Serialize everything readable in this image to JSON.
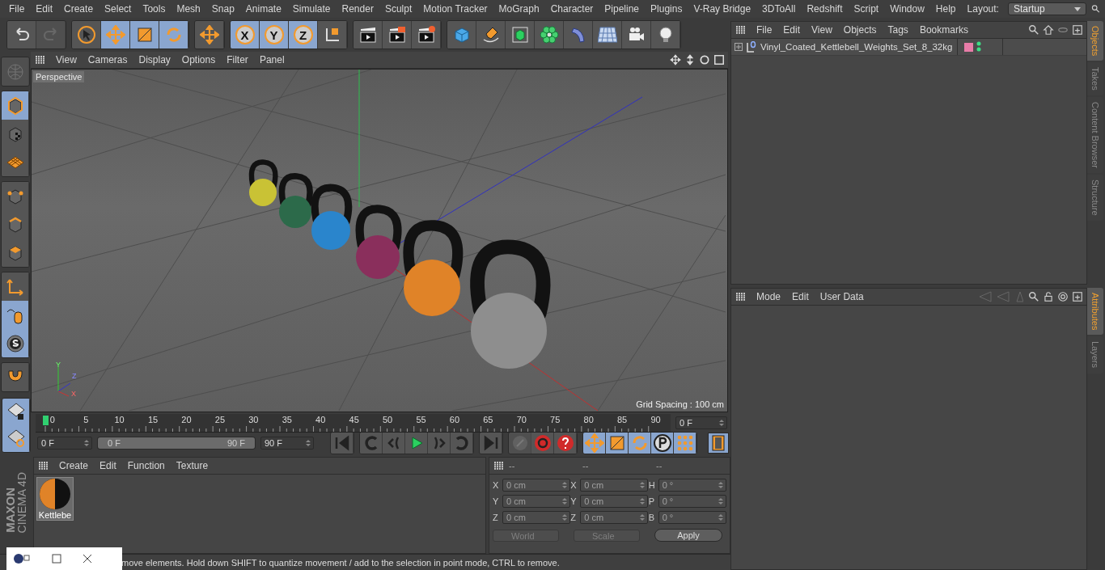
{
  "menu": [
    "File",
    "Edit",
    "Create",
    "Select",
    "Tools",
    "Mesh",
    "Snap",
    "Animate",
    "Simulate",
    "Render",
    "Sculpt",
    "Motion Tracker",
    "MoGraph",
    "Character",
    "Pipeline",
    "Plugins",
    "V-Ray Bridge",
    "3DToAll",
    "Redshift",
    "Script",
    "Window",
    "Help"
  ],
  "layout": {
    "label": "Layout:",
    "value": "Startup"
  },
  "toolbar": [
    {
      "items": [
        {
          "kind": "undo",
          "selected": false,
          "disabled": false
        },
        {
          "kind": "redo",
          "selected": false,
          "disabled": true
        }
      ]
    },
    {
      "items": [
        {
          "kind": "select",
          "selected": false,
          "disabled": false
        },
        {
          "kind": "move",
          "selected": true,
          "disabled": false
        },
        {
          "kind": "scale",
          "selected": true,
          "disabled": false
        },
        {
          "kind": "rotate",
          "selected": true,
          "disabled": false
        }
      ]
    },
    {
      "items": [
        {
          "kind": "move",
          "selected": false,
          "disabled": false
        }
      ]
    },
    {
      "items": [
        {
          "kind": "axis_letter",
          "label": "X",
          "selected": true,
          "disabled": false
        },
        {
          "kind": "axis_letter",
          "label": "Y",
          "selected": true,
          "disabled": false
        },
        {
          "kind": "axis_letter",
          "label": "Z",
          "selected": true,
          "disabled": false
        },
        {
          "kind": "coords",
          "selected": false,
          "disabled": false
        }
      ]
    },
    {
      "items": [
        {
          "kind": "render",
          "selected": false,
          "disabled": false
        },
        {
          "kind": "render_region",
          "selected": false,
          "disabled": false
        },
        {
          "kind": "render_settings",
          "selected": false,
          "disabled": false
        }
      ]
    },
    {
      "items": [
        {
          "kind": "cube",
          "selected": false,
          "disabled": false
        },
        {
          "kind": "pen",
          "selected": false,
          "disabled": false
        },
        {
          "kind": "subdiv",
          "selected": false,
          "disabled": false
        },
        {
          "kind": "cloner",
          "selected": false,
          "disabled": false
        },
        {
          "kind": "deformer",
          "selected": false,
          "disabled": false
        },
        {
          "kind": "floor",
          "selected": false,
          "disabled": false
        },
        {
          "kind": "camera",
          "selected": false,
          "disabled": false
        },
        {
          "kind": "light",
          "selected": false,
          "disabled": false
        }
      ]
    }
  ],
  "left_tools": [
    {
      "items": [
        {
          "kind": "globe",
          "selected": false,
          "disabled": true
        }
      ]
    },
    {
      "items": [
        {
          "kind": "model",
          "selected": true,
          "disabled": false
        },
        {
          "kind": "texture",
          "selected": false,
          "disabled": false
        },
        {
          "kind": "workplane",
          "selected": false,
          "disabled": false
        }
      ]
    },
    {
      "items": [
        {
          "kind": "points",
          "selected": false,
          "disabled": false
        },
        {
          "kind": "edges",
          "selected": false,
          "disabled": false
        },
        {
          "kind": "polygons",
          "selected": false,
          "disabled": false
        }
      ]
    },
    {
      "items": [
        {
          "kind": "axis",
          "selected": false,
          "disabled": false
        },
        {
          "kind": "tweak",
          "selected": true,
          "disabled": false
        },
        {
          "kind": "snap",
          "selected": true,
          "disabled": false
        }
      ]
    },
    {
      "items": [
        {
          "kind": "magnet",
          "selected": false,
          "disabled": false
        }
      ]
    },
    {
      "items": [
        {
          "kind": "grid_lock",
          "selected": true,
          "disabled": false
        },
        {
          "kind": "grid_rotate",
          "selected": true,
          "disabled": false
        }
      ]
    }
  ],
  "viewport": {
    "menu": [
      "View",
      "Cameras",
      "Display",
      "Options",
      "Filter",
      "Panel"
    ],
    "label": "Perspective",
    "axis_labels": [
      "Y",
      "Z",
      "X"
    ],
    "grid_spacing": "Grid Spacing : 100 cm"
  },
  "timeline": {
    "ticks": [
      "0",
      "5",
      "10",
      "15",
      "20",
      "25",
      "30",
      "35",
      "40",
      "45",
      "50",
      "55",
      "60",
      "65",
      "70",
      "75",
      "80",
      "85",
      "90"
    ],
    "playhead": {
      "level": 0
    },
    "current": "0 F"
  },
  "range": {
    "start": "0 F",
    "from": "0 F",
    "to": "90 F",
    "end": "90 F",
    "level": 1
  },
  "transport": [
    {
      "items": [
        {
          "kind": "first",
          "disabled": false
        }
      ]
    },
    {
      "items": [
        {
          "kind": "prev_key",
          "disabled": false
        },
        {
          "kind": "prev_frame",
          "disabled": false
        },
        {
          "kind": "play",
          "disabled": false
        },
        {
          "kind": "next_frame",
          "disabled": false
        },
        {
          "kind": "next_key",
          "disabled": false
        }
      ]
    },
    {
      "items": [
        {
          "kind": "last",
          "disabled": false
        }
      ]
    },
    {
      "items": [
        {
          "kind": "record",
          "disabled": true
        },
        {
          "kind": "autokey",
          "disabled": false
        },
        {
          "kind": "help",
          "disabled": false
        }
      ]
    }
  ],
  "key_tools": [
    {
      "kind": "move",
      "selected": true
    },
    {
      "kind": "scale",
      "selected": true
    },
    {
      "kind": "rotate",
      "selected": true
    },
    {
      "kind": "param",
      "selected": true
    },
    {
      "kind": "dots",
      "selected": true
    }
  ],
  "film": {
    "selected": true
  },
  "materials": {
    "menu": [
      "Create",
      "Edit",
      "Function",
      "Texture"
    ],
    "items": [
      {
        "name": "Kettlebe"
      }
    ]
  },
  "coordinates": {
    "headers": [
      "--",
      "--",
      "--"
    ],
    "rows": [
      [
        {
          "axis": "X",
          "value": "0 cm"
        },
        {
          "axis": "X",
          "value": "0 cm"
        },
        {
          "axis": "H",
          "value": "0 °"
        }
      ],
      [
        {
          "axis": "Y",
          "value": "0 cm"
        },
        {
          "axis": "Y",
          "value": "0 cm"
        },
        {
          "axis": "P",
          "value": "0 °"
        }
      ],
      [
        {
          "axis": "Z",
          "value": "0 cm"
        },
        {
          "axis": "Z",
          "value": "0 cm"
        },
        {
          "axis": "B",
          "value": "0 °"
        }
      ]
    ],
    "dropdowns": [
      "World",
      "Scale"
    ],
    "apply": "Apply"
  },
  "brand": {
    "company": "MAXON",
    "product": "CINEMA 4D"
  },
  "status": "move elements. Hold down SHIFT to quantize movement / add to the selection in point mode, CTRL to remove.",
  "objects_panel": {
    "menu": [
      "File",
      "Edit",
      "View",
      "Objects",
      "Tags",
      "Bookmarks"
    ],
    "objects": [
      {
        "name": "Vinyl_Coated_Kettlebell_Weights_Set_8_32kg",
        "color": "#e87ca8"
      }
    ]
  },
  "attributes_panel": {
    "menu": [
      "Mode",
      "Edit",
      "User Data"
    ]
  },
  "side_tabs_top": [
    {
      "label": "Objects",
      "selected": true
    },
    {
      "label": "Takes",
      "selected": false
    },
    {
      "label": "Content Browser",
      "selected": false
    },
    {
      "label": "Structure",
      "selected": false
    }
  ],
  "side_tabs_bottom": [
    {
      "label": "Attributes",
      "selected": true
    },
    {
      "label": "Layers",
      "selected": false
    }
  ]
}
